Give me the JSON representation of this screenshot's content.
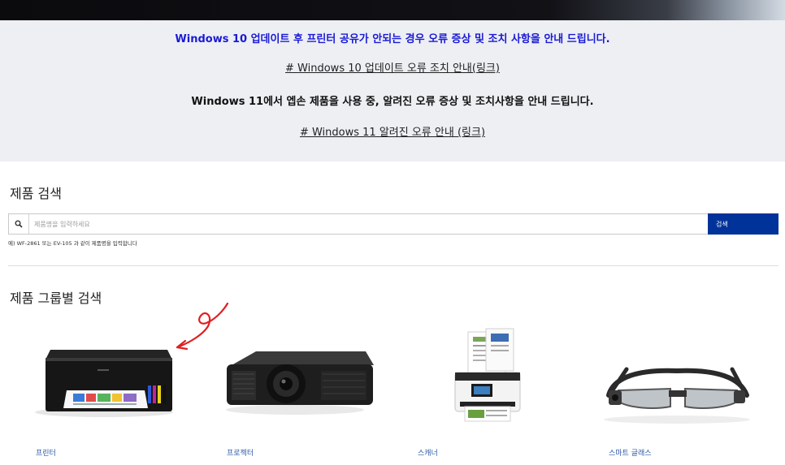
{
  "notice": {
    "win10_alert": "Windows 10 업데이트 후 프린터 공유가 안되는 경우 오류 증상 및 조치 사항을 안내 드립니다.",
    "win10_link": "# Windows 10 업데이트 오류 조치 안내(링크)",
    "win11_alert": "Windows 11에서 엡손 제품을 사용 중, 알려진 오류 증상 및 조치사항을 안내 드립니다.",
    "win11_link": "# Windows 11 알려진 오류 안내 (링크)"
  },
  "search": {
    "heading": "제품 검색",
    "placeholder": "제품명을 입력하세요",
    "value": "",
    "button_label": "검색",
    "hint": "예) WF-2861 또는 EV-105 과 같이 제품명을 입력합니다"
  },
  "groups": {
    "heading": "제품 그룹별 검색",
    "items": [
      {
        "label": "프린터",
        "icon": "printer-image"
      },
      {
        "label": "프로젝터",
        "icon": "projector-image"
      },
      {
        "label": "스캐너",
        "icon": "scanner-image"
      },
      {
        "label": "스마트 글래스",
        "icon": "smart-glasses-image"
      }
    ]
  },
  "colors": {
    "alert_text": "#1a1ad6",
    "search_button": "#003399",
    "link_label": "#2b5aa8",
    "annotation": "#e02020"
  }
}
